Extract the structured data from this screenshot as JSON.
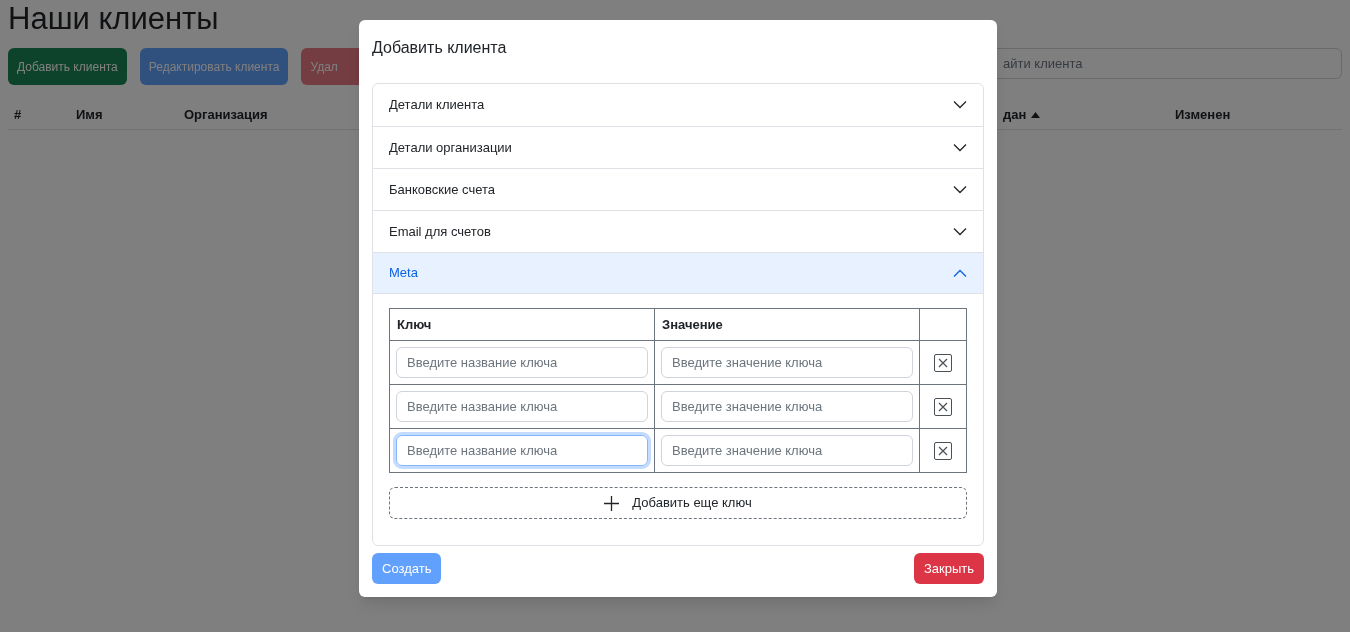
{
  "page": {
    "title": "Наши клиенты",
    "buttons": [
      {
        "label": "Добавить клиента",
        "kind": "success",
        "disabled": false
      },
      {
        "label": "Редактировать клиента",
        "kind": "primary",
        "disabled": true
      },
      {
        "label": "Удал",
        "kind": "danger",
        "disabled": true
      }
    ],
    "search": {
      "placeholder": "айти клиента"
    },
    "table": {
      "columns": [
        {
          "label": "#",
          "sorted": false
        },
        {
          "label": "Имя",
          "sorted": false
        },
        {
          "label": "Организация",
          "sorted": false
        },
        {
          "label": "дан",
          "sorted": true
        },
        {
          "label": "Изменен",
          "sorted": false
        }
      ]
    }
  },
  "modal": {
    "title": "Добавить клиента",
    "sections": [
      {
        "label": "Детали клиента",
        "expanded": false
      },
      {
        "label": "Детали организации",
        "expanded": false
      },
      {
        "label": "Банковские счета",
        "expanded": false
      },
      {
        "label": "Email для счетов",
        "expanded": false
      },
      {
        "label": "Meta",
        "expanded": true
      }
    ],
    "meta_table": {
      "columns": [
        "Ключ",
        "Значение"
      ],
      "rows": [
        {
          "key_placeholder": "Введите название ключа",
          "value_placeholder": "Введите значение ключа",
          "focused": false
        },
        {
          "key_placeholder": "Введите название ключа",
          "value_placeholder": "Введите значение ключа",
          "focused": false
        },
        {
          "key_placeholder": "Введите название ключа",
          "value_placeholder": "Введите значение ключа",
          "focused": true
        }
      ]
    },
    "add_button": "Добавить еще ключ",
    "footer": {
      "create": {
        "label": "Создать",
        "disabled": true
      },
      "close": {
        "label": "Закрыть"
      }
    }
  }
}
